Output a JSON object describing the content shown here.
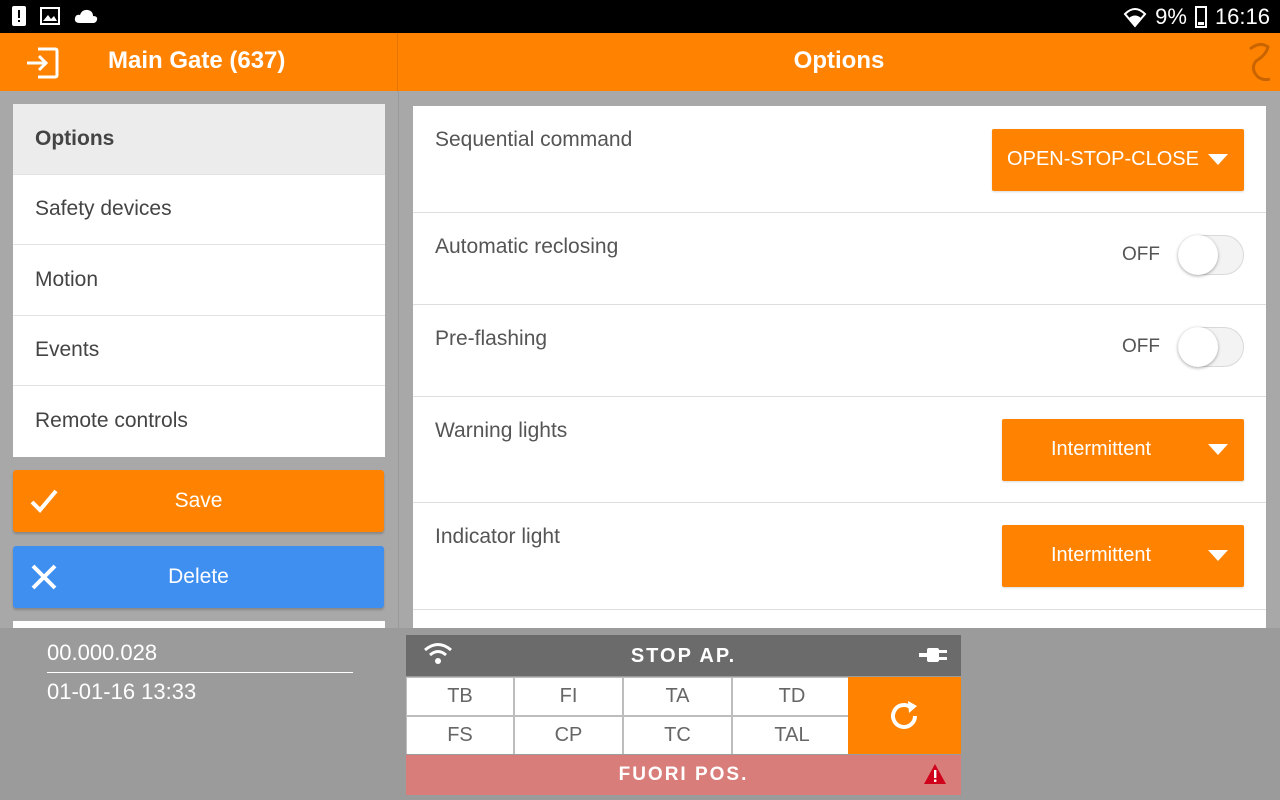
{
  "status_bar": {
    "battery_percent": "9%",
    "time": "16:16"
  },
  "app_bar": {
    "device_title": "Main Gate (637)",
    "page_title": "Options"
  },
  "sidebar": {
    "items": [
      {
        "label": "Options",
        "active": true
      },
      {
        "label": "Safety devices",
        "active": false
      },
      {
        "label": "Motion",
        "active": false
      },
      {
        "label": "Events",
        "active": false
      },
      {
        "label": "Remote controls",
        "active": false
      }
    ],
    "save_label": "Save",
    "delete_label": "Delete"
  },
  "options": {
    "sequential_command": {
      "label": "Sequential command",
      "value": "OPEN-STOP-CLOSE"
    },
    "automatic_reclosing": {
      "label": "Automatic reclosing",
      "state": "OFF"
    },
    "pre_flashing": {
      "label": "Pre-flashing",
      "state": "OFF"
    },
    "warning_lights": {
      "label": "Warning lights",
      "value": "Intermittent"
    },
    "indicator_light": {
      "label": "Indicator light",
      "value": "Intermittent"
    }
  },
  "device_info": {
    "code": "00.000.028",
    "datetime": "01-01-16 13:33"
  },
  "status_panel": {
    "header": "STOP AP.",
    "cells": [
      "TB",
      "FI",
      "TA",
      "TD",
      "FS",
      "CP",
      "TC",
      "TAL"
    ],
    "footer": "FUORI POS."
  },
  "colors": {
    "accent": "#ff8300",
    "delete": "#3f8ff1",
    "alarm": "#d97d7a",
    "header_dark": "#6b6b6b"
  }
}
